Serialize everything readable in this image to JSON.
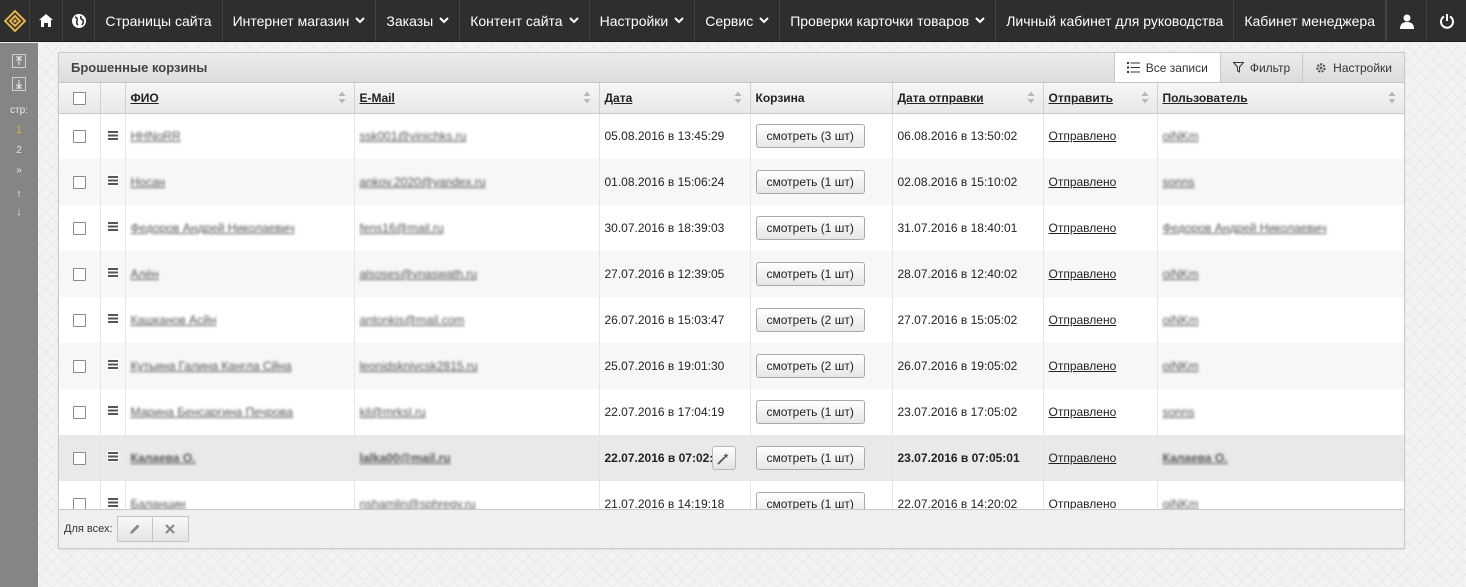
{
  "nav": {
    "items": [
      {
        "label": "Страницы сайта",
        "dropdown": false
      },
      {
        "label": "Интернет магазин",
        "dropdown": true
      },
      {
        "label": "Заказы",
        "dropdown": true
      },
      {
        "label": "Контент сайта",
        "dropdown": true
      },
      {
        "label": "Настройки",
        "dropdown": true
      },
      {
        "label": "Сервис",
        "dropdown": true
      },
      {
        "label": "Проверки карточки товаров",
        "dropdown": true
      },
      {
        "label": "Личный кабинет для руководства",
        "dropdown": false
      },
      {
        "label": "Кабинет менеджера",
        "dropdown": false
      }
    ],
    "icons": [
      "logo-icon",
      "home-icon",
      "globe-icon",
      "user-icon",
      "power-icon"
    ]
  },
  "rail": {
    "pages_label": "стр:",
    "pages": [
      "1",
      "2"
    ],
    "active_page": "1",
    "next": "»",
    "up": "↑",
    "down": "↓"
  },
  "panel": {
    "title": "Брошенные корзины",
    "buttons": {
      "all": "Все записи",
      "filter": "Фильтр",
      "settings": "Настройки"
    }
  },
  "table": {
    "headers": {
      "fio": "ФИО",
      "email": "E-Mail",
      "date": "Дата",
      "cart": "Корзина",
      "sent_date": "Дата отправки",
      "send": "Отправить",
      "user": "Пользователь"
    },
    "rows": [
      {
        "fio": "HHNoRR",
        "email": "ssk001@vinichks.ru",
        "date": "05.08.2016 в 13:45:29",
        "cart": "смотреть (3 шт)",
        "sent_date": "06.08.2016 в 13:50:02",
        "send": "Отправлено",
        "user": "oiNKm"
      },
      {
        "fio": "Носан",
        "email": "ankov.2020@yandex.ru",
        "date": "01.08.2016 в 15:06:24",
        "cart": "смотреть (1 шт)",
        "sent_date": "02.08.2016 в 15:10:02",
        "send": "Отправлено",
        "user": "sonns"
      },
      {
        "fio": "Федоров Андрей Николаевич",
        "email": "fens16@mail.ru",
        "date": "30.07.2016 в 18:39:03",
        "cart": "смотреть (1 шт)",
        "sent_date": "31.07.2016 в 18:40:01",
        "send": "Отправлено",
        "user": "Федоров Андрей Николаевич"
      },
      {
        "fio": "Алён",
        "email": "alsoses@vnaswath.ru",
        "date": "27.07.2016 в 12:39:05",
        "cart": "смотреть (1 шт)",
        "sent_date": "28.07.2016 в 12:40:02",
        "send": "Отправлено",
        "user": "oiNKm"
      },
      {
        "fio": "Кашканов Асйн",
        "email": "antonkis@mail.com",
        "date": "26.07.2016 в 15:03:47",
        "cart": "смотреть (2 шт)",
        "sent_date": "27.07.2016 в 15:05:02",
        "send": "Отправлено",
        "user": "oiNKm"
      },
      {
        "fio": "Кутьина Галина Кангла Сйна",
        "email": "leonidsknivcsk2815.ru",
        "date": "25.07.2016 в 19:01:30",
        "cart": "смотреть (2 шт)",
        "sent_date": "26.07.2016 в 19:05:02",
        "send": "Отправлено",
        "user": "oiNKm"
      },
      {
        "fio": "Марина Бенсаргина Печрова",
        "email": "kil@mrksl.ru",
        "date": "22.07.2016 в 17:04:19",
        "cart": "смотреть (1 шт)",
        "sent_date": "23.07.2016 в 17:05:02",
        "send": "Отправлено",
        "user": "sonns"
      },
      {
        "fio": "Калаева О.",
        "email": "lalka00@mail.ru",
        "date": "22.07.2016 в 07:02:5",
        "cart": "смотреть (1 шт)",
        "sent_date": "23.07.2016 в 07:05:01",
        "send": "Отправлено",
        "user": "Калаева О."
      },
      {
        "fio": "Баланцин",
        "email": "nshamlin@sphregy.ru",
        "date": "21.07.2016 в 14:19:18",
        "cart": "смотреть (1 шт)",
        "sent_date": "22.07.2016 в 14:20:02",
        "send": "Отправлено",
        "user": "oiNKm"
      }
    ],
    "highlighted_row": 7
  },
  "footer": {
    "label": "Для всех:"
  },
  "colors": {
    "topbar": "#2e2e2e",
    "rail": "#858585",
    "accent": "#e6b24a"
  }
}
